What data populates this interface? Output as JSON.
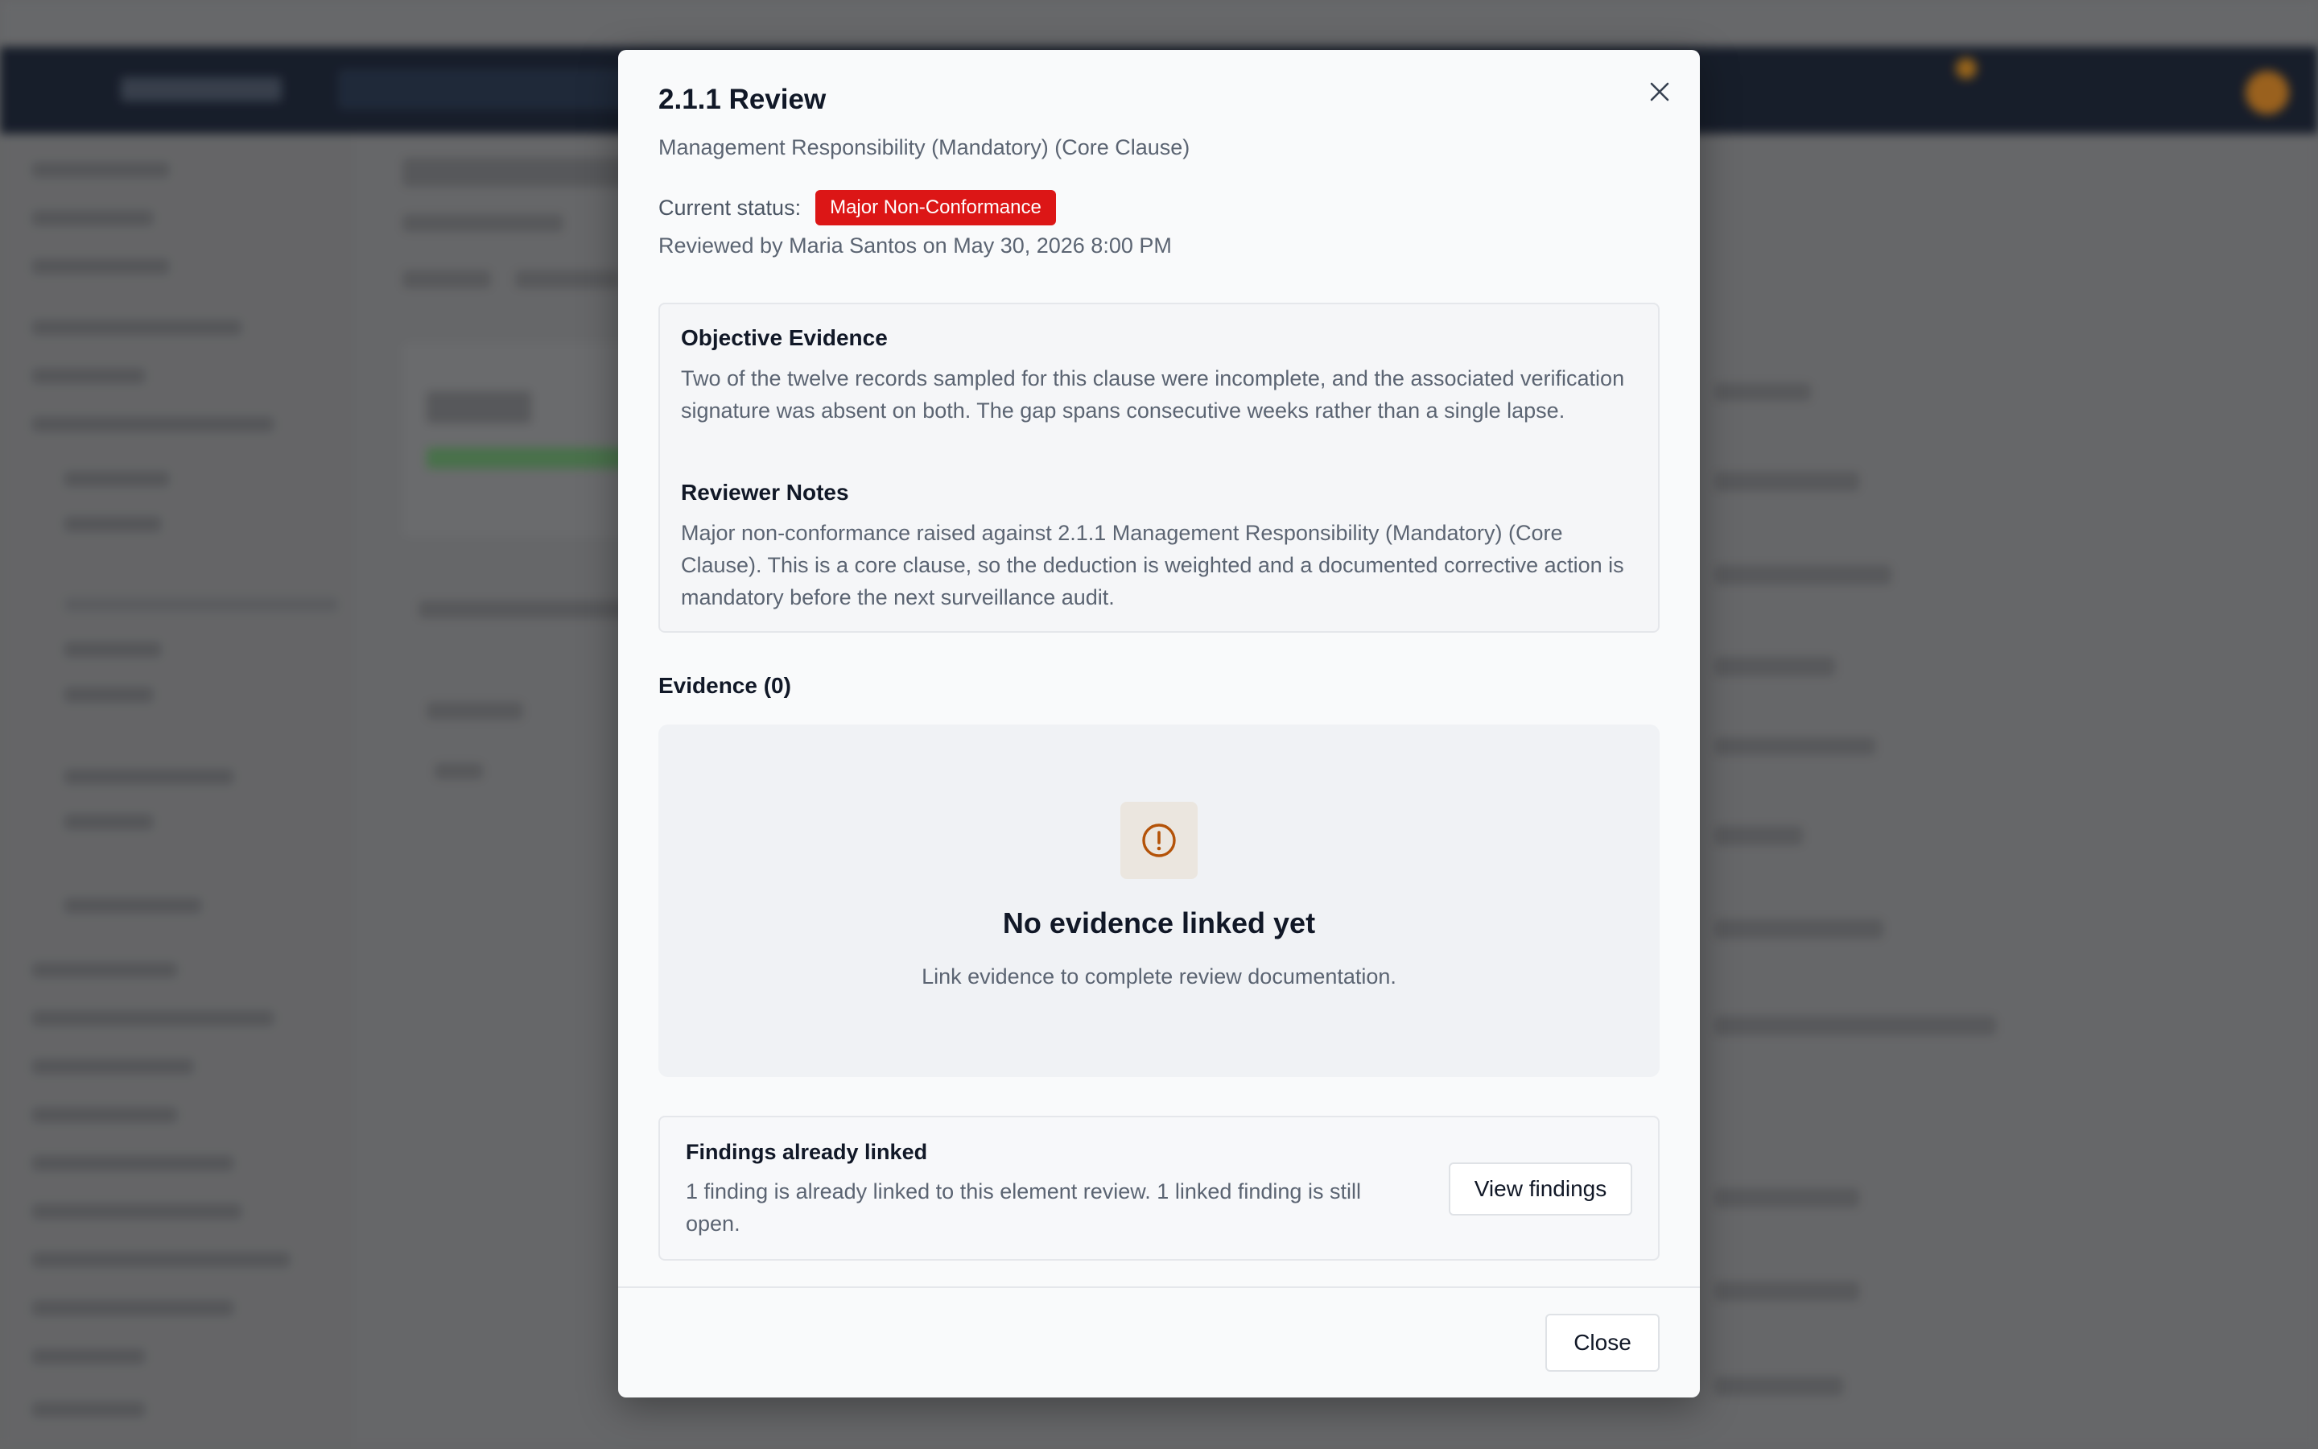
{
  "modal": {
    "title": "2.1.1 Review",
    "subtitle": "Management Responsibility (Mandatory) (Core Clause)",
    "status_label": "Current status:",
    "status_badge": "Major Non-Conformance",
    "reviewed_by": "Reviewed by Maria Santos on May 30, 2026 8:00 PM",
    "objective_evidence": {
      "heading": "Objective Evidence",
      "text": "Two of the twelve records sampled for this clause were incomplete, and the associated verification signature was absent on both. The gap spans consecutive weeks rather than a single lapse."
    },
    "reviewer_notes": {
      "heading": "Reviewer Notes",
      "text": "Major non-conformance raised against 2.1.1 Management Responsibility (Mandatory) (Core Clause). This is a core clause, so the deduction is weighted and a documented corrective action is mandatory before the next surveillance audit."
    },
    "evidence_heading": "Evidence (0)",
    "empty_state": {
      "icon": "alert-circle-icon",
      "title": "No evidence linked yet",
      "subtitle": "Link evidence to complete review documentation."
    },
    "findings": {
      "title": "Findings already linked",
      "text": "1 finding is already linked to this element review. 1 linked finding is still open.",
      "button_label": "View findings"
    },
    "close_label": "Close"
  },
  "colors": {
    "badge_red": "#dc1616",
    "warning_orange": "#b45309",
    "nav_dark": "#161d2b"
  }
}
